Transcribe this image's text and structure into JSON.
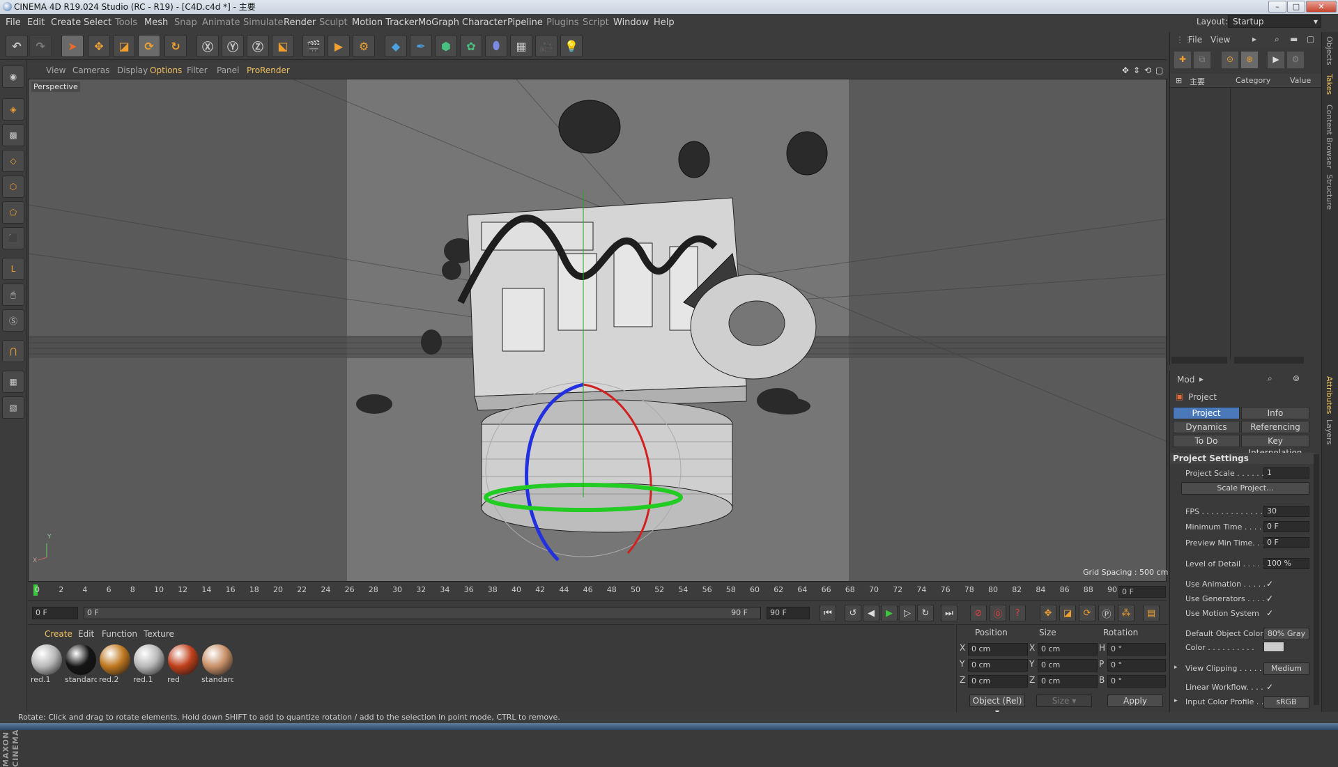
{
  "window": {
    "title": "CINEMA 4D R19.024 Studio (RC - R19) - [C4D.c4d *] - 主要",
    "minimize_glyph": "–",
    "maximize_glyph": "□",
    "close_glyph": "✕"
  },
  "menubar": {
    "items": [
      "File",
      "Edit",
      "Create",
      "Select",
      "Tools",
      "Mesh",
      "Snap",
      "Animate",
      "Simulate",
      "Render",
      "Sculpt",
      "Motion Tracker",
      "MoGraph",
      "Character",
      "Pipeline",
      "Plugins",
      "Script",
      "Window",
      "Help"
    ],
    "layout_label": "Layout:",
    "layout_value": "Startup"
  },
  "viewport": {
    "menu": [
      "View",
      "Cameras",
      "Display",
      "Options",
      "Filter",
      "Panel",
      "ProRender"
    ],
    "camera_label": "Perspective",
    "grid_spacing": "Grid Spacing : 500 cm",
    "axis_y": "Y",
    "axis_x": "X"
  },
  "timeline": {
    "ticks": [
      "0",
      "2",
      "4",
      "6",
      "8",
      "10",
      "12",
      "14",
      "16",
      "18",
      "20",
      "22",
      "24",
      "26",
      "28",
      "30",
      "32",
      "34",
      "36",
      "38",
      "40",
      "42",
      "44",
      "46",
      "48",
      "50",
      "52",
      "54",
      "56",
      "58",
      "60",
      "62",
      "64",
      "66",
      "68",
      "70",
      "72",
      "74",
      "76",
      "78",
      "80",
      "82",
      "84",
      "86",
      "88",
      "90"
    ],
    "current_frame": "0 F",
    "start_field": "0 F",
    "slider_start": "0 F",
    "slider_end": "90 F",
    "end_field": "90 F"
  },
  "materials": {
    "menu": [
      "Create",
      "Edit",
      "Function",
      "Texture"
    ],
    "items": [
      {
        "name": "red.1",
        "color": "#b8b8b8"
      },
      {
        "name": "standard",
        "color": "#151515"
      },
      {
        "name": "red.2",
        "color": "#c07820"
      },
      {
        "name": "red.1",
        "color": "#b8b8b8"
      },
      {
        "name": "red",
        "color": "#c0401c"
      },
      {
        "name": "standard",
        "color": "#c89068"
      }
    ]
  },
  "coordinates": {
    "headers": [
      "Position",
      "Size",
      "Rotation"
    ],
    "rows": [
      {
        "axis": "X",
        "pos": "0 cm",
        "size_axis": "X",
        "size": "0 cm",
        "rot_axis": "H",
        "rot": "0 °"
      },
      {
        "axis": "Y",
        "pos": "0 cm",
        "size_axis": "Y",
        "size": "0 cm",
        "rot_axis": "P",
        "rot": "0 °"
      },
      {
        "axis": "Z",
        "pos": "0 cm",
        "size_axis": "Z",
        "size": "0 cm",
        "rot_axis": "B",
        "rot": "0 °"
      }
    ],
    "mode": "Object (Rel)",
    "size_mode": "Size",
    "apply_label": "Apply"
  },
  "objects_panel": {
    "menu": [
      "File",
      "View"
    ],
    "columns": [
      "主要",
      "Category",
      "Value"
    ]
  },
  "attributes": {
    "mode_label": "Mod",
    "object_label": "Project",
    "tabs": [
      {
        "label": "Project Settings",
        "selected": true
      },
      {
        "label": "Info",
        "selected": false
      },
      {
        "label": "Dynamics",
        "selected": false
      },
      {
        "label": "Referencing",
        "selected": false
      },
      {
        "label": "To Do",
        "selected": false
      },
      {
        "label": "Key Interpolation",
        "selected": false
      }
    ],
    "section_title": "Project Settings",
    "project_scale_label": "Project Scale . . . . . . .",
    "project_scale_value": "1",
    "scale_project_button": "Scale Project...",
    "fps_label": "FPS . . . . . . . . . . . . . . .",
    "fps_value": "30",
    "min_time_label": "Minimum Time . . . . .",
    "min_time_value": "0 F",
    "preview_min_label": "Preview Min Time. . .",
    "preview_min_value": "0 F",
    "lod_label": "Level of Detail . . . . . .",
    "lod_value": "100 %",
    "use_animation_label": "Use Animation . . . . .",
    "use_generators_label": "Use Generators . . . . .",
    "use_motion_label": "Use Motion System",
    "check_glyph": "✓",
    "default_color_label": "Default Object Color",
    "default_color_value": "80% Gray",
    "color_label": "Color . . . . . . . . . .",
    "view_clipping_label": "View Clipping . . . . . .",
    "view_clipping_value": "Medium",
    "linear_workflow_label": "Linear Workflow. . . .",
    "input_color_label": "Input Color Profile . .",
    "input_color_value": "sRGB"
  },
  "side_tabs": [
    "Objects",
    "Takes",
    "Content Browser",
    "Structure",
    "Attributes",
    "Layers"
  ],
  "status": "Rotate: Click and drag to rotate elements. Hold down SHIFT to add to quantize rotation / add to the selection in point mode, CTRL to remove.",
  "maxon_logo": "MAXON CINEMA 4D",
  "colors": {
    "accent": "#4b78b8",
    "highlight": "#f0c060",
    "panel": "#3a3a3a",
    "viewport": "#5c5c5c"
  }
}
